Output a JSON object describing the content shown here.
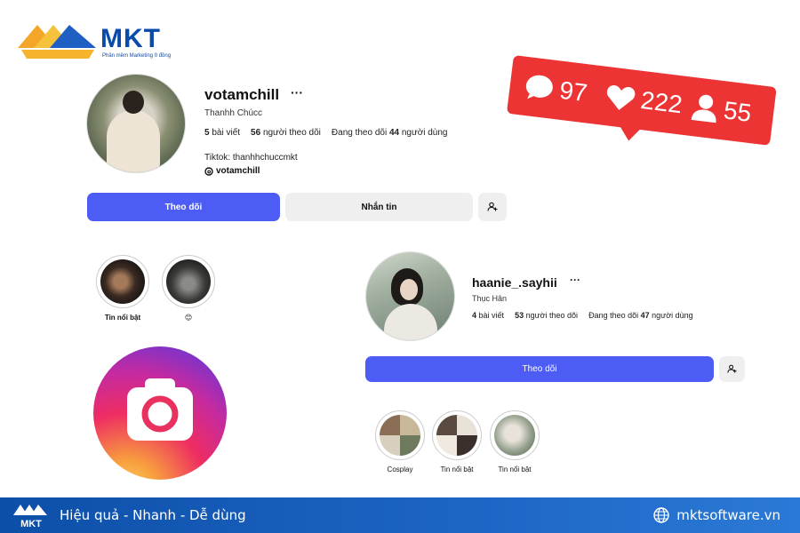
{
  "brand": {
    "logo_text": "MKT",
    "logo_subtitle": "Phần mềm Marketing 0 đồng"
  },
  "notification": {
    "comments": "97",
    "likes": "222",
    "followers": "55",
    "color": "#ec3434"
  },
  "profile1": {
    "username": "votamchill",
    "more": "···",
    "full_name": "Thanhh Chúcc",
    "posts_count": "5",
    "posts_label": "bài viết",
    "followers_count": "56",
    "followers_label": "người theo dõi",
    "following_prefix": "Đang theo dõi",
    "following_count": "44",
    "following_label": "người dùng",
    "bio": "Tiktok: thanhhchuccmkt",
    "threads": "votamchill",
    "follow_button": "Theo dõi",
    "message_button": "Nhắn tin",
    "highlights": [
      {
        "label": "Tin nổi bật"
      },
      {
        "label": "😊"
      }
    ]
  },
  "profile2": {
    "username": "haanie_.sayhii",
    "more": "···",
    "full_name": "Thục Hân",
    "posts_count": "4",
    "posts_label": "bài viết",
    "followers_count": "53",
    "followers_label": "người theo dõi",
    "following_prefix": "Đang theo dõi",
    "following_count": "47",
    "following_label": "người dùng",
    "follow_button": "Theo dõi",
    "highlights": [
      {
        "label": "Cosplay"
      },
      {
        "label": "Tin nổi bật"
      },
      {
        "label": "Tin nổi bật"
      }
    ]
  },
  "footer": {
    "tagline": "Hiệu quả - Nhanh - Dễ dùng",
    "website": "mktsoftware.vn",
    "logo_text": "MKT"
  },
  "colors": {
    "accent_blue": "#4c5cf5",
    "footer_blue": "#1e66c5",
    "brand_blue": "#0b4aa8"
  }
}
